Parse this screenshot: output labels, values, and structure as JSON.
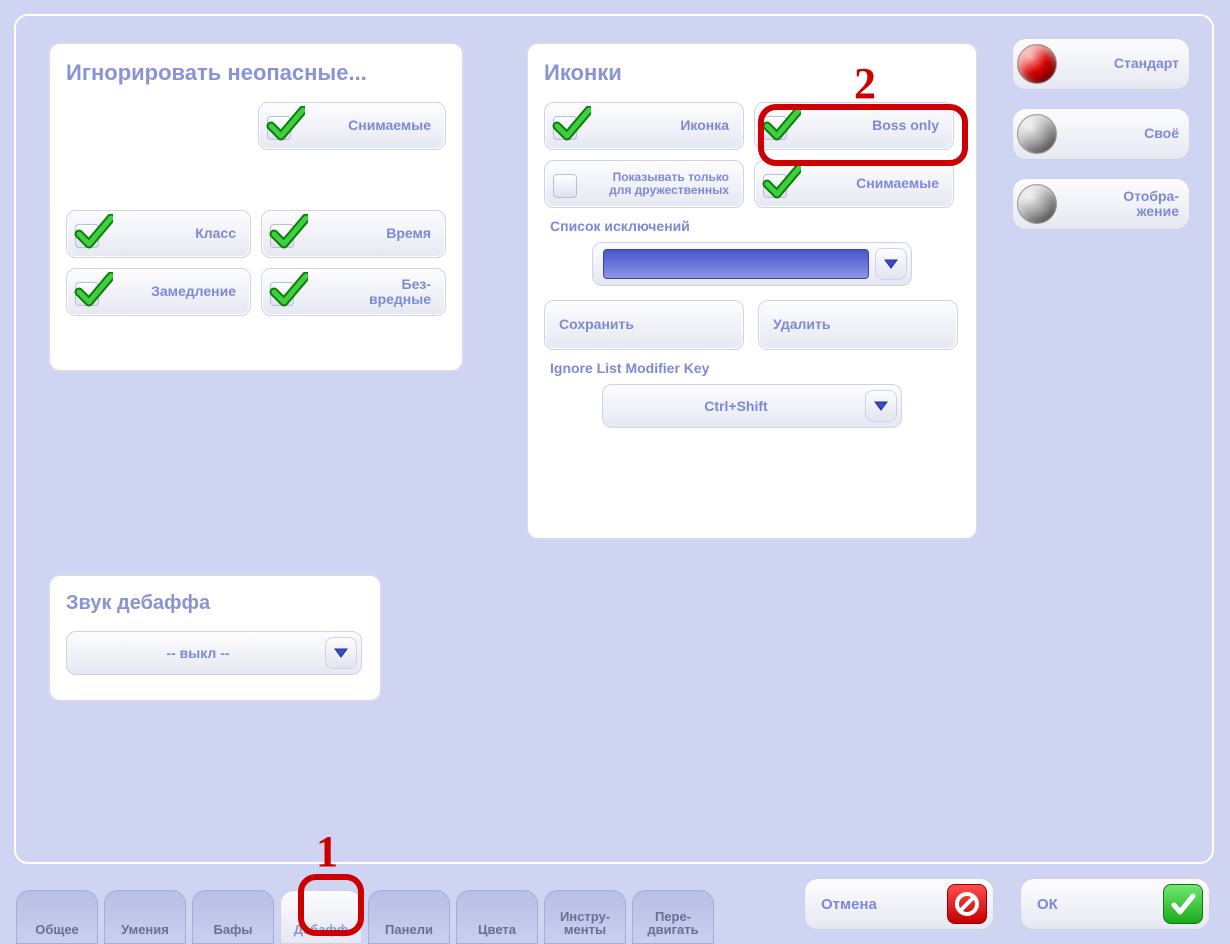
{
  "groups": {
    "ignore": {
      "title": "Игнорировать неопасные...",
      "removable": "Снимаемые",
      "class": "Класс",
      "time": "Время",
      "slow": "Замедление",
      "harmless": "Без-\nвредные"
    },
    "icons": {
      "title": "Иконки",
      "icon": "Иконка",
      "boss_only": "Boss only",
      "friendly_only": "Показывать только для дружественных",
      "removable": "Снимаемые",
      "exclusion_list": "Список исключений",
      "save": "Сохранить",
      "delete": "Удалить",
      "modifier_label": "Ignore List Modifier Key",
      "modifier_value": "Ctrl+Shift"
    },
    "sound": {
      "title": "Звук дебаффа",
      "value": "-- выкл --"
    }
  },
  "side": {
    "standard": "Стандарт",
    "own": "Своё",
    "display": "Отобра-\nжение"
  },
  "tabs": {
    "general": "Общее",
    "skills": "Умения",
    "buffs": "Бафы",
    "debuffs": "Дебафф",
    "panels": "Панели",
    "colors": "Цвета",
    "tools": "Инстру-\nменты",
    "move": "Пере-\nдвигать"
  },
  "footer": {
    "cancel": "Отмена",
    "ok": "ОК"
  },
  "annotations": {
    "one": "1",
    "two": "2"
  }
}
